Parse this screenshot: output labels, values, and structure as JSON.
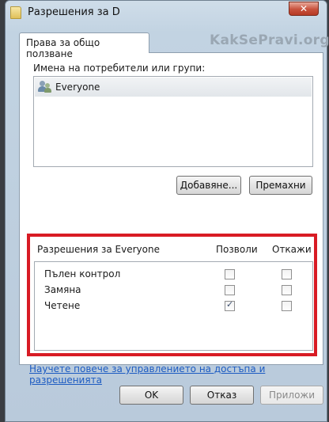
{
  "window": {
    "title": "Разрешения за D",
    "close_label": "✕"
  },
  "watermark": "KakSePravi.org",
  "tab": {
    "label": "Права за общо ползване"
  },
  "users": {
    "label": "Имена на потребители или групи:",
    "items": [
      {
        "name": "Everyone"
      }
    ],
    "add_button": "Добавяне...",
    "remove_button": "Премахни"
  },
  "permissions": {
    "label": "Разрешения за Everyone",
    "allow_header": "Позволи",
    "deny_header": "Откажи",
    "rows": [
      {
        "name": "Пълен контрол",
        "allow": false,
        "deny": false
      },
      {
        "name": "Замяна",
        "allow": false,
        "deny": false
      },
      {
        "name": "Четене",
        "allow": true,
        "deny": false
      }
    ],
    "highlight_color": "#d81b24"
  },
  "help_link": "Научете повече за управлението на достъпа и разрешенията",
  "footer": {
    "ok": "OK",
    "cancel": "Отказ",
    "apply": "Приложи"
  }
}
